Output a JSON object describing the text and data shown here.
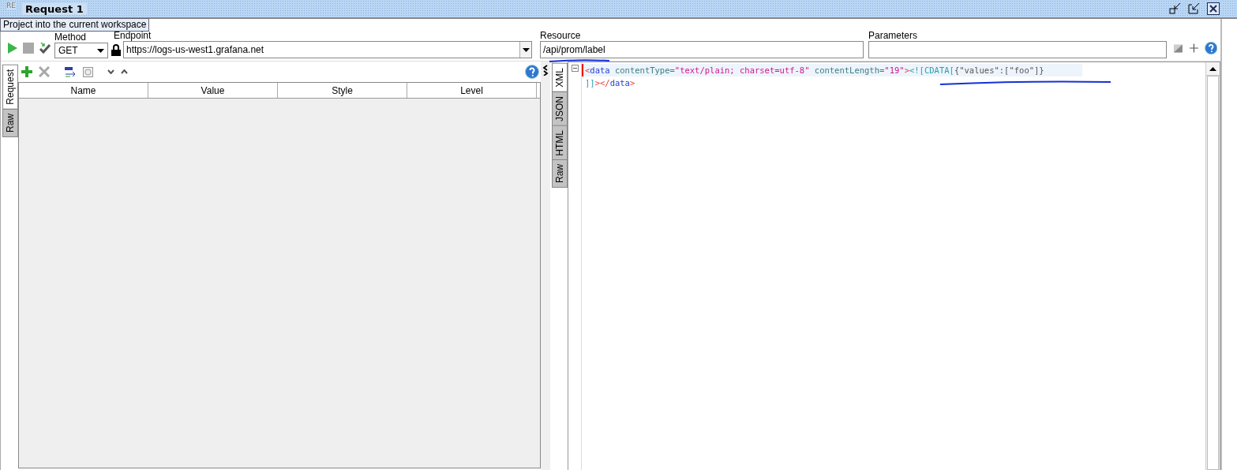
{
  "window": {
    "app_badge": "RE",
    "title": "Request 1",
    "tooltip": "Project into the current workspace"
  },
  "toolbar": {
    "method": {
      "label": "Method",
      "value": "GET"
    },
    "endpoint": {
      "label": "Endpoint",
      "value": "https://logs-us-west1.grafana.net"
    },
    "resource": {
      "label": "Resource",
      "value": "/api/prom/label"
    },
    "parameters": {
      "label": "Parameters"
    }
  },
  "request_panel": {
    "tabs": [
      {
        "label": "Request",
        "selected": true
      },
      {
        "label": "Raw",
        "selected": false
      }
    ],
    "table": {
      "columns": [
        "Name",
        "Value",
        "Style",
        "Level"
      ]
    }
  },
  "response_panel": {
    "tabs": [
      {
        "label": "XML",
        "selected": true
      },
      {
        "label": "JSON",
        "selected": false
      },
      {
        "label": "HTML",
        "selected": false
      },
      {
        "label": "Raw",
        "selected": false
      }
    ],
    "lines": [
      [
        {
          "kind": "bracket",
          "text": "<"
        },
        {
          "kind": "tag",
          "text": "data"
        },
        {
          "kind": "attr",
          "text": " contentType"
        },
        {
          "kind": "punct",
          "text": "="
        },
        {
          "kind": "value",
          "text": "\"text/plain; charset=utf-8\""
        },
        {
          "kind": "attr",
          "text": " contentLength"
        },
        {
          "kind": "punct",
          "text": "="
        },
        {
          "kind": "value",
          "text": "\"19\""
        },
        {
          "kind": "bracket",
          "text": ">"
        },
        {
          "kind": "cdata",
          "text": "<![CDATA["
        },
        {
          "kind": "text",
          "text": "{\"values\":[\"foo\"]}"
        }
      ],
      [
        {
          "kind": "cdata",
          "text": "]]"
        },
        {
          "kind": "bracket",
          "text": "></"
        },
        {
          "kind": "tag",
          "text": "data"
        },
        {
          "kind": "bracket",
          "text": ">"
        }
      ]
    ]
  }
}
